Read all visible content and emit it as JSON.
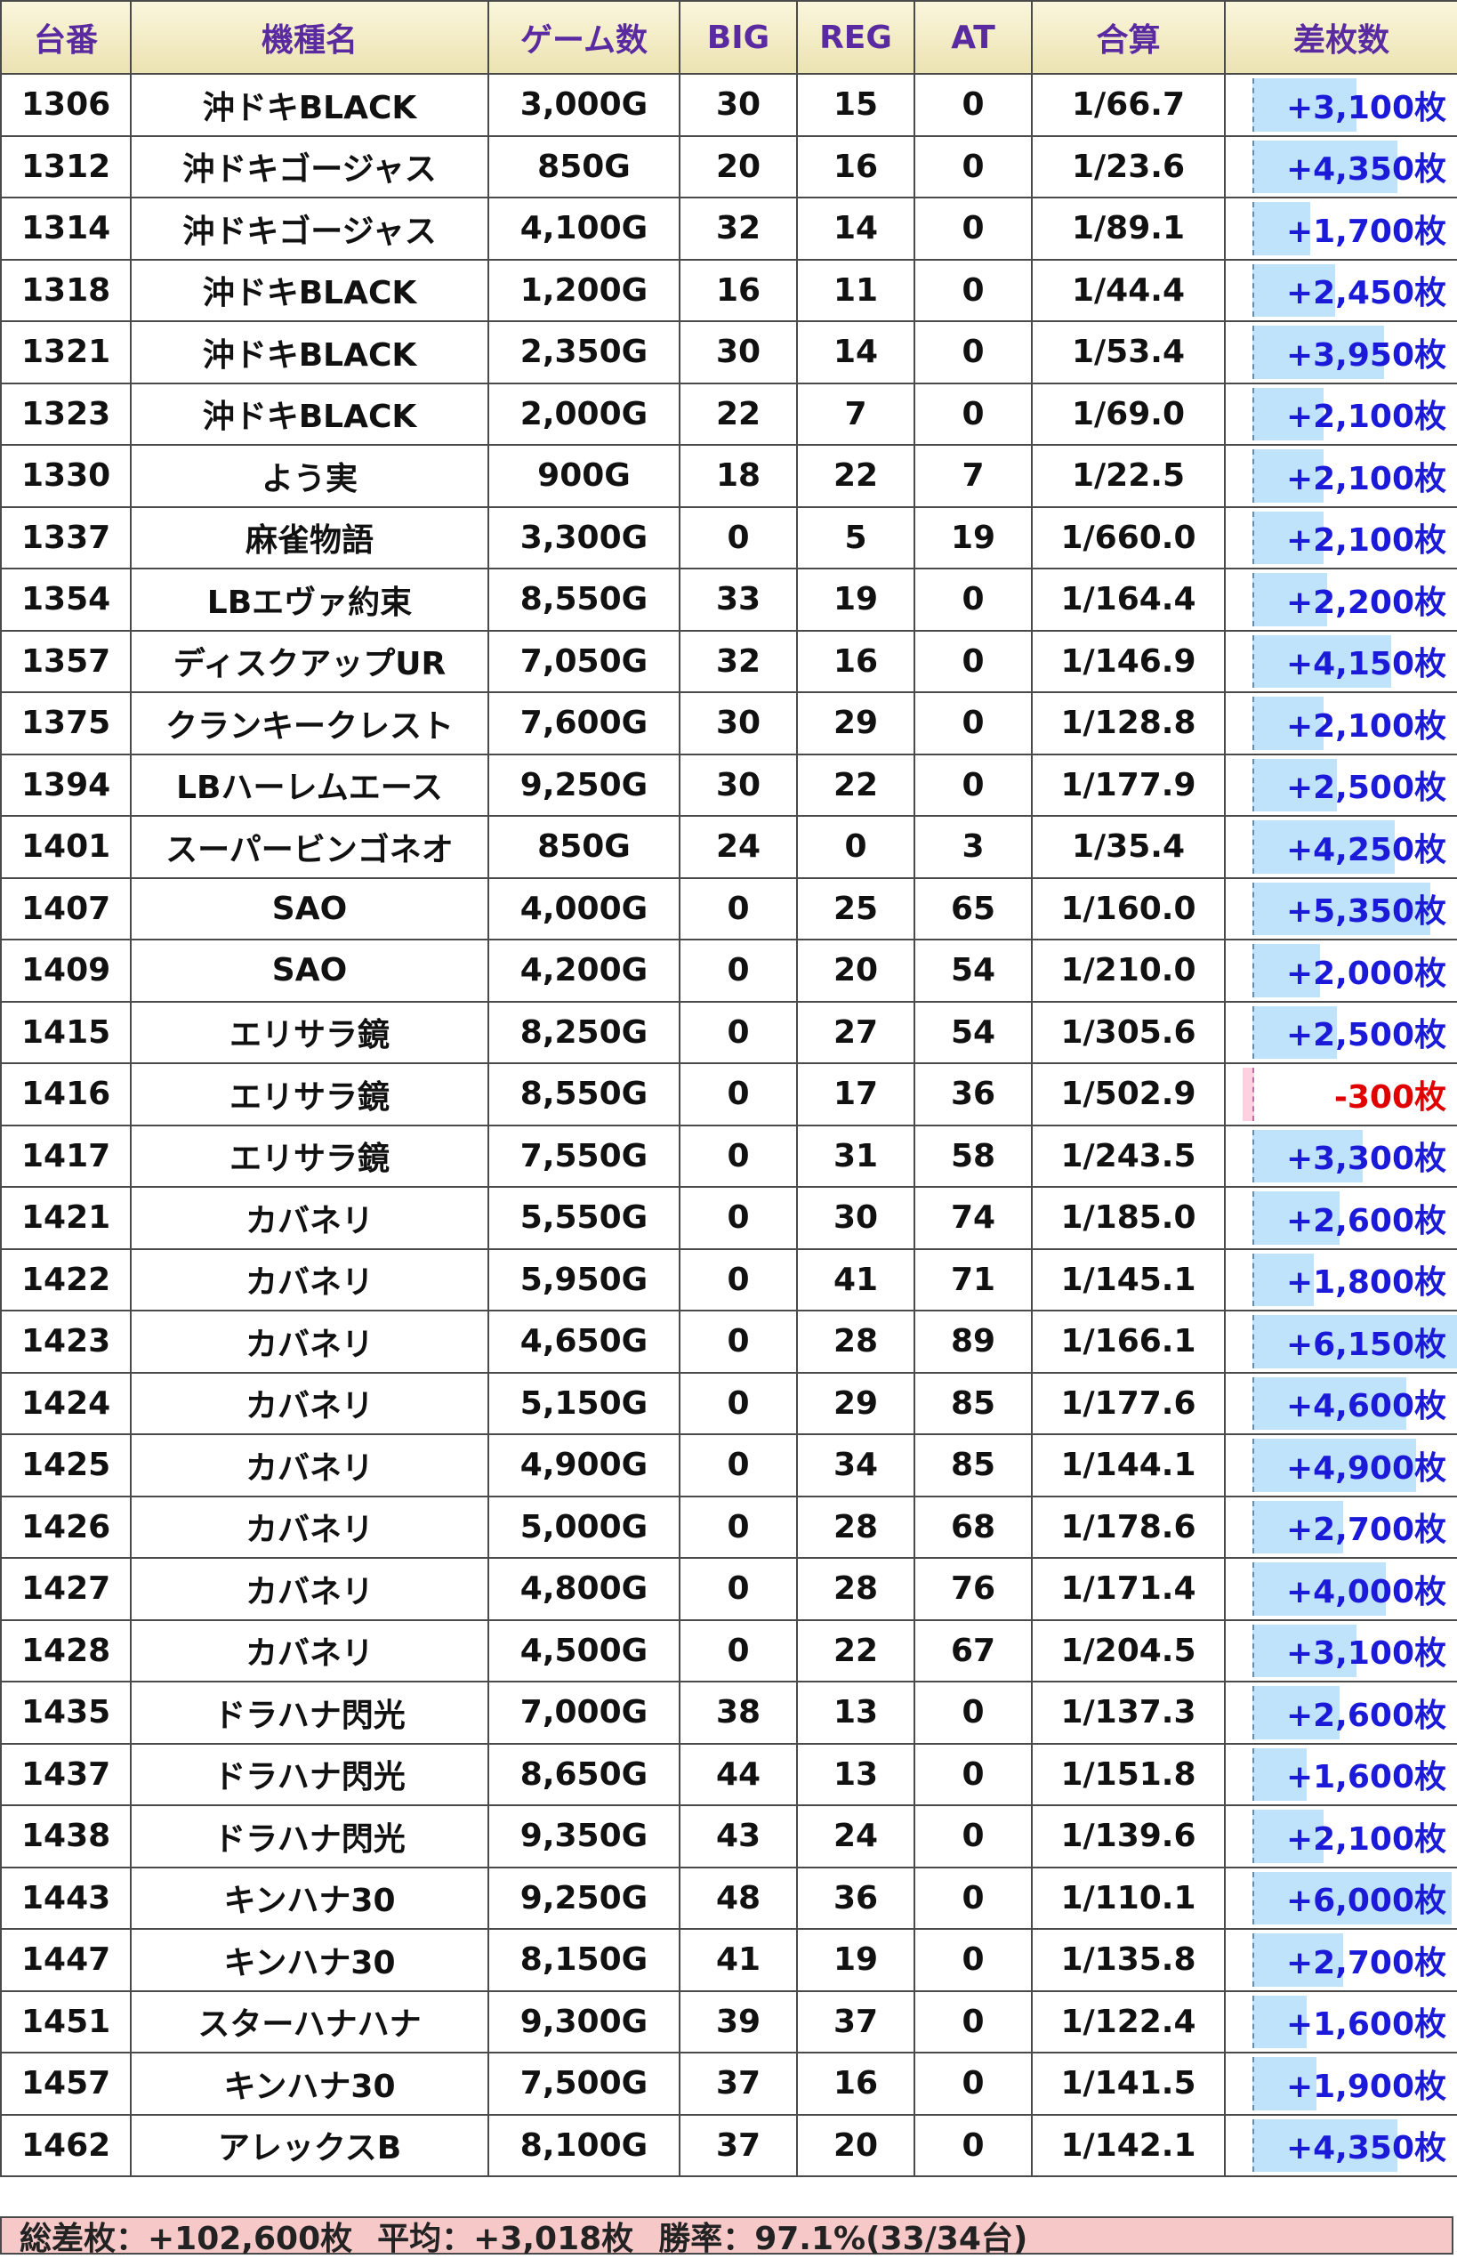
{
  "headers": [
    "台番",
    "機種名",
    "ゲーム数",
    "BIG",
    "REG",
    "AT",
    "合算",
    "差枚数"
  ],
  "rows": [
    {
      "id": "1306",
      "name": "沖ドキBLACK",
      "games": "3,000G",
      "big": "30",
      "reg": "15",
      "at": "0",
      "total": "1/66.7",
      "diff": "+3,100枚",
      "diff_value": 3100
    },
    {
      "id": "1312",
      "name": "沖ドキゴージャス",
      "games": "850G",
      "big": "20",
      "reg": "16",
      "at": "0",
      "total": "1/23.6",
      "diff": "+4,350枚",
      "diff_value": 4350
    },
    {
      "id": "1314",
      "name": "沖ドキゴージャス",
      "games": "4,100G",
      "big": "32",
      "reg": "14",
      "at": "0",
      "total": "1/89.1",
      "diff": "+1,700枚",
      "diff_value": 1700
    },
    {
      "id": "1318",
      "name": "沖ドキBLACK",
      "games": "1,200G",
      "big": "16",
      "reg": "11",
      "at": "0",
      "total": "1/44.4",
      "diff": "+2,450枚",
      "diff_value": 2450
    },
    {
      "id": "1321",
      "name": "沖ドキBLACK",
      "games": "2,350G",
      "big": "30",
      "reg": "14",
      "at": "0",
      "total": "1/53.4",
      "diff": "+3,950枚",
      "diff_value": 3950
    },
    {
      "id": "1323",
      "name": "沖ドキBLACK",
      "games": "2,000G",
      "big": "22",
      "reg": "7",
      "at": "0",
      "total": "1/69.0",
      "diff": "+2,100枚",
      "diff_value": 2100
    },
    {
      "id": "1330",
      "name": "よう実",
      "games": "900G",
      "big": "18",
      "reg": "22",
      "at": "7",
      "total": "1/22.5",
      "diff": "+2,100枚",
      "diff_value": 2100
    },
    {
      "id": "1337",
      "name": "麻雀物語",
      "games": "3,300G",
      "big": "0",
      "reg": "5",
      "at": "19",
      "total": "1/660.0",
      "diff": "+2,100枚",
      "diff_value": 2100
    },
    {
      "id": "1354",
      "name": "LBエヴァ約束",
      "games": "8,550G",
      "big": "33",
      "reg": "19",
      "at": "0",
      "total": "1/164.4",
      "diff": "+2,200枚",
      "diff_value": 2200
    },
    {
      "id": "1357",
      "name": "ディスクアップUR",
      "games": "7,050G",
      "big": "32",
      "reg": "16",
      "at": "0",
      "total": "1/146.9",
      "diff": "+4,150枚",
      "diff_value": 4150
    },
    {
      "id": "1375",
      "name": "クランキークレスト",
      "games": "7,600G",
      "big": "30",
      "reg": "29",
      "at": "0",
      "total": "1/128.8",
      "diff": "+2,100枚",
      "diff_value": 2100
    },
    {
      "id": "1394",
      "name": "LBハーレムエース",
      "games": "9,250G",
      "big": "30",
      "reg": "22",
      "at": "0",
      "total": "1/177.9",
      "diff": "+2,500枚",
      "diff_value": 2500
    },
    {
      "id": "1401",
      "name": "スーパービンゴネオ",
      "games": "850G",
      "big": "24",
      "reg": "0",
      "at": "3",
      "total": "1/35.4",
      "diff": "+4,250枚",
      "diff_value": 4250
    },
    {
      "id": "1407",
      "name": "SAO",
      "games": "4,000G",
      "big": "0",
      "reg": "25",
      "at": "65",
      "total": "1/160.0",
      "diff": "+5,350枚",
      "diff_value": 5350
    },
    {
      "id": "1409",
      "name": "SAO",
      "games": "4,200G",
      "big": "0",
      "reg": "20",
      "at": "54",
      "total": "1/210.0",
      "diff": "+2,000枚",
      "diff_value": 2000
    },
    {
      "id": "1415",
      "name": "エリサラ鏡",
      "games": "8,250G",
      "big": "0",
      "reg": "27",
      "at": "54",
      "total": "1/305.6",
      "diff": "+2,500枚",
      "diff_value": 2500
    },
    {
      "id": "1416",
      "name": "エリサラ鏡",
      "games": "8,550G",
      "big": "0",
      "reg": "17",
      "at": "36",
      "total": "1/502.9",
      "diff": "-300枚",
      "diff_value": -300
    },
    {
      "id": "1417",
      "name": "エリサラ鏡",
      "games": "7,550G",
      "big": "0",
      "reg": "31",
      "at": "58",
      "total": "1/243.5",
      "diff": "+3,300枚",
      "diff_value": 3300
    },
    {
      "id": "1421",
      "name": "カバネリ",
      "games": "5,550G",
      "big": "0",
      "reg": "30",
      "at": "74",
      "total": "1/185.0",
      "diff": "+2,600枚",
      "diff_value": 2600
    },
    {
      "id": "1422",
      "name": "カバネリ",
      "games": "5,950G",
      "big": "0",
      "reg": "41",
      "at": "71",
      "total": "1/145.1",
      "diff": "+1,800枚",
      "diff_value": 1800
    },
    {
      "id": "1423",
      "name": "カバネリ",
      "games": "4,650G",
      "big": "0",
      "reg": "28",
      "at": "89",
      "total": "1/166.1",
      "diff": "+6,150枚",
      "diff_value": 6150
    },
    {
      "id": "1424",
      "name": "カバネリ",
      "games": "5,150G",
      "big": "0",
      "reg": "29",
      "at": "85",
      "total": "1/177.6",
      "diff": "+4,600枚",
      "diff_value": 4600
    },
    {
      "id": "1425",
      "name": "カバネリ",
      "games": "4,900G",
      "big": "0",
      "reg": "34",
      "at": "85",
      "total": "1/144.1",
      "diff": "+4,900枚",
      "diff_value": 4900
    },
    {
      "id": "1426",
      "name": "カバネリ",
      "games": "5,000G",
      "big": "0",
      "reg": "28",
      "at": "68",
      "total": "1/178.6",
      "diff": "+2,700枚",
      "diff_value": 2700
    },
    {
      "id": "1427",
      "name": "カバネリ",
      "games": "4,800G",
      "big": "0",
      "reg": "28",
      "at": "76",
      "total": "1/171.4",
      "diff": "+4,000枚",
      "diff_value": 4000
    },
    {
      "id": "1428",
      "name": "カバネリ",
      "games": "4,500G",
      "big": "0",
      "reg": "22",
      "at": "67",
      "total": "1/204.5",
      "diff": "+3,100枚",
      "diff_value": 3100
    },
    {
      "id": "1435",
      "name": "ドラハナ閃光",
      "games": "7,000G",
      "big": "38",
      "reg": "13",
      "at": "0",
      "total": "1/137.3",
      "diff": "+2,600枚",
      "diff_value": 2600
    },
    {
      "id": "1437",
      "name": "ドラハナ閃光",
      "games": "8,650G",
      "big": "44",
      "reg": "13",
      "at": "0",
      "total": "1/151.8",
      "diff": "+1,600枚",
      "diff_value": 1600
    },
    {
      "id": "1438",
      "name": "ドラハナ閃光",
      "games": "9,350G",
      "big": "43",
      "reg": "24",
      "at": "0",
      "total": "1/139.6",
      "diff": "+2,100枚",
      "diff_value": 2100
    },
    {
      "id": "1443",
      "name": "キンハナ30",
      "games": "9,250G",
      "big": "48",
      "reg": "36",
      "at": "0",
      "total": "1/110.1",
      "diff": "+6,000枚",
      "diff_value": 6000
    },
    {
      "id": "1447",
      "name": "キンハナ30",
      "games": "8,150G",
      "big": "41",
      "reg": "19",
      "at": "0",
      "total": "1/135.8",
      "diff": "+2,700枚",
      "diff_value": 2700
    },
    {
      "id": "1451",
      "name": "スターハナハナ",
      "games": "9,300G",
      "big": "39",
      "reg": "37",
      "at": "0",
      "total": "1/122.4",
      "diff": "+1,600枚",
      "diff_value": 1600
    },
    {
      "id": "1457",
      "name": "キンハナ30",
      "games": "7,500G",
      "big": "37",
      "reg": "16",
      "at": "0",
      "total": "1/141.5",
      "diff": "+1,900枚",
      "diff_value": 1900
    },
    {
      "id": "1462",
      "name": "アレックスB",
      "games": "8,100G",
      "big": "37",
      "reg": "20",
      "at": "0",
      "total": "1/142.1",
      "diff": "+4,350枚",
      "diff_value": 4350
    }
  ],
  "footer": {
    "total": "総差枚：+102,600枚",
    "average": "平均：+3,018枚",
    "win_rate": "勝率：97.1%(33/34台)"
  },
  "colors": {
    "header_text": "#5a2aa0",
    "positive": "#1a1ad8",
    "negative": "#e00000",
    "bar_fill": "#bfe3fb",
    "footer_bg": "#f7c8c8"
  }
}
